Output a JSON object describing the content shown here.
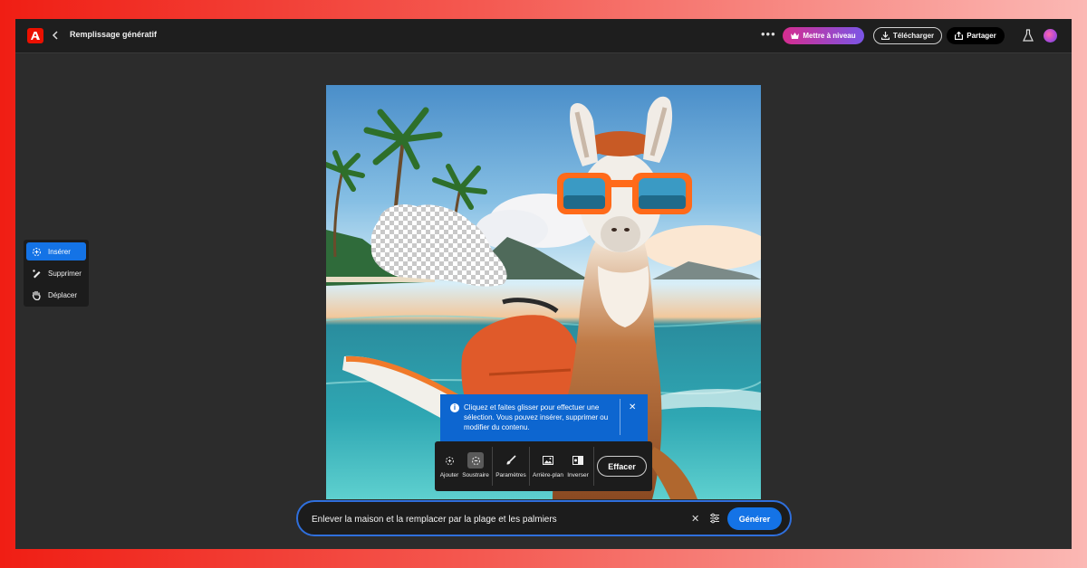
{
  "header": {
    "back_icon": "chevron-left-icon",
    "title": "Remplissage génératif",
    "more_label": "•••",
    "upgrade_label": "Mettre à niveau",
    "download_label": "Télécharger",
    "share_label": "Partager"
  },
  "left_tools": [
    {
      "label": "Insérer",
      "icon": "insert-brush-icon",
      "active": true
    },
    {
      "label": "Supprimer",
      "icon": "remove-brush-icon",
      "active": false
    },
    {
      "label": "Déplacer",
      "icon": "hand-icon",
      "active": false
    }
  ],
  "info": {
    "text": "Cliquez et faites glisser pour effectuer une sélection. Vous pouvez insérer, supprimer ou modifier du contenu.",
    "icon": "i",
    "close": "✕"
  },
  "selection_tools": {
    "add_label": "Ajouter",
    "subtract_label": "Soustraire",
    "settings_label": "Paramètres",
    "background_label": "Arrière-plan",
    "invert_label": "Inverser",
    "clear_label": "Effacer"
  },
  "prompt": {
    "value": "Enlever la maison et la remplacer par la plage et les palmiers",
    "clear": "✕",
    "generate_label": "Générer"
  },
  "colors": {
    "accent": "#1473e6",
    "brand": "#eb1000",
    "info_bg": "#0d66d0"
  }
}
